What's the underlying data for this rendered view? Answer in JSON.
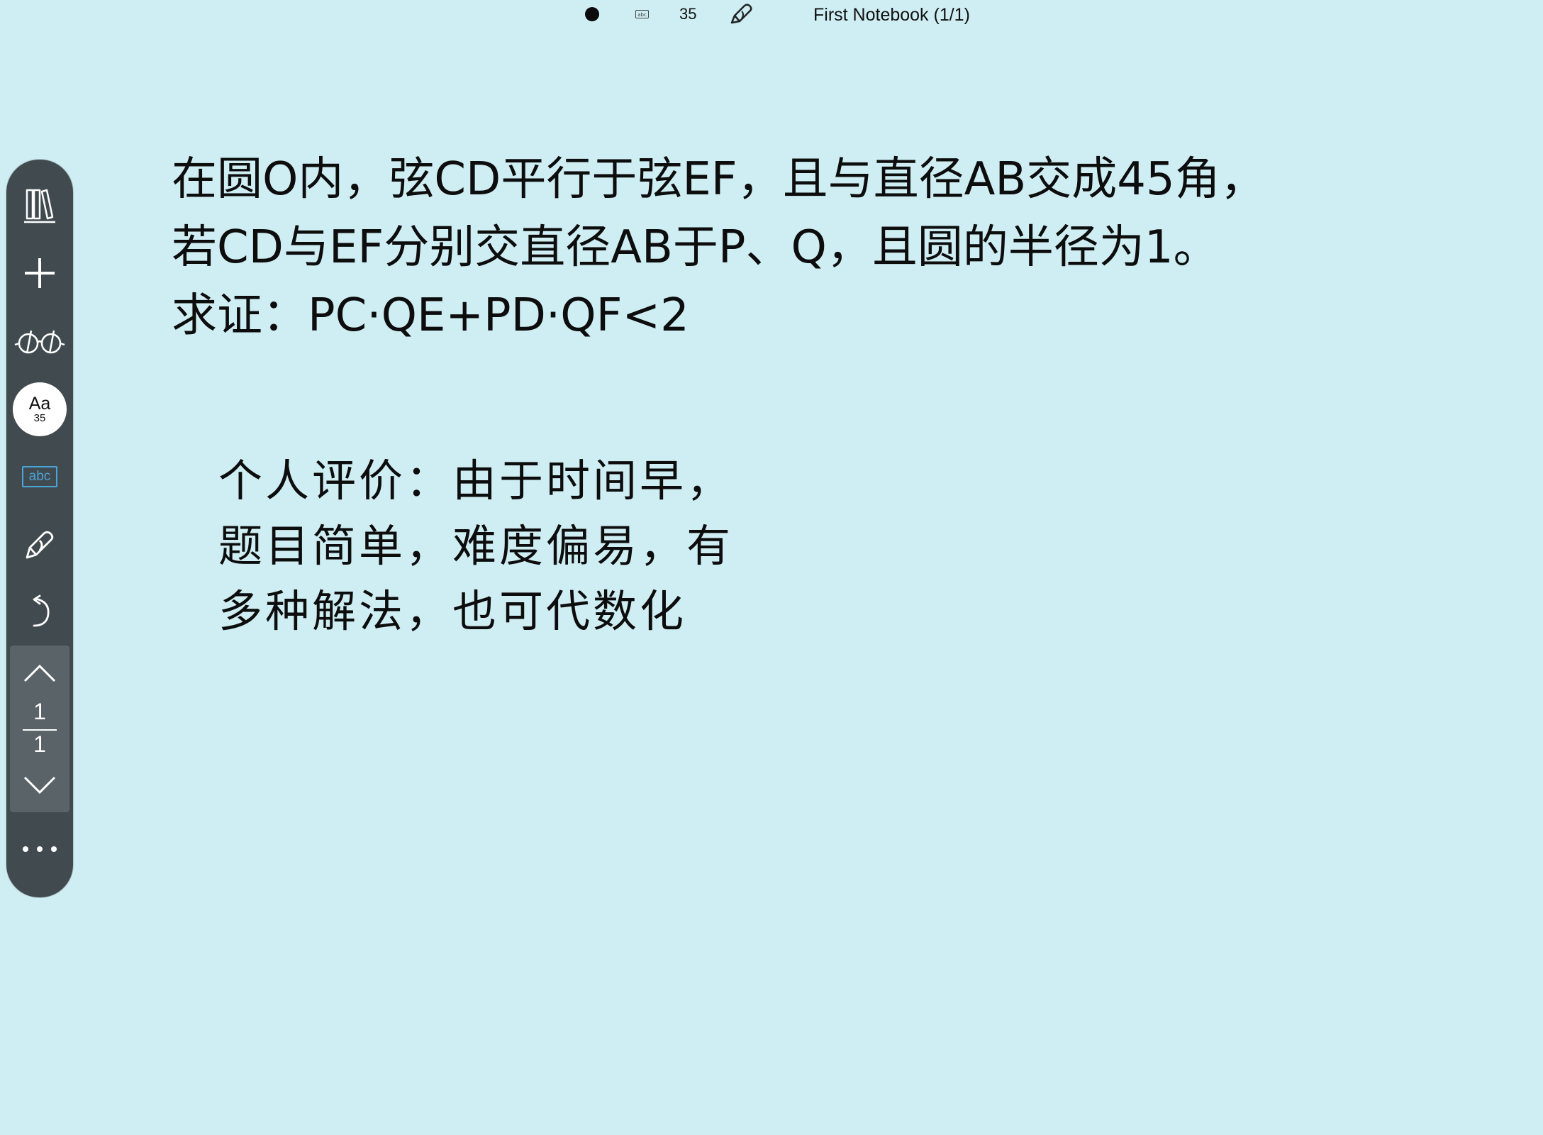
{
  "status_bar": {
    "pen_color": "#0b0b0b",
    "mode_icon_label": "abc",
    "font_size": "35",
    "title": "First Notebook (1/1)"
  },
  "toolbar": {
    "font_button": {
      "label": "Aa",
      "size": "35"
    },
    "abc_button_label": "abc",
    "pager": {
      "current": "1",
      "total": "1"
    },
    "accent_color": "#4aa3d9"
  },
  "note": {
    "problem_lines": [
      "在圆O内，弦CD平行于弦EF，且与直径AB交成45角，",
      "若CD与EF分别交直径AB于P、Q，且圆的半径为1。",
      "求证：PC·QE+PD·QF<2"
    ],
    "comment_lines": [
      "个人评价：由于时间早，",
      "题目简单，难度偏易，有",
      "多种解法，也可代数化"
    ]
  }
}
